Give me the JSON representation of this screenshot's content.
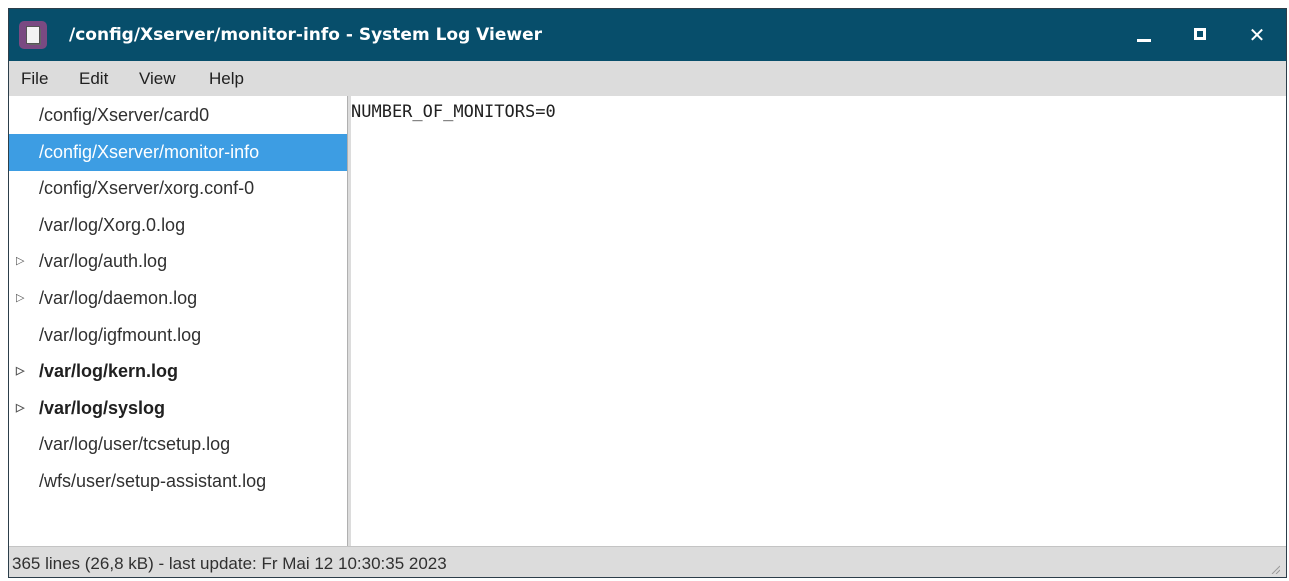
{
  "window": {
    "title": "/config/Xserver/monitor-info - System Log Viewer",
    "close_glyph": "✕"
  },
  "menu": [
    "File",
    "Edit",
    "View",
    "Help"
  ],
  "sidebar": {
    "items": [
      {
        "label": "/config/Xserver/card0",
        "expandable": false,
        "bold": false,
        "selected": false
      },
      {
        "label": "/config/Xserver/monitor-info",
        "expandable": false,
        "bold": false,
        "selected": true
      },
      {
        "label": "/config/Xserver/xorg.conf-0",
        "expandable": false,
        "bold": false,
        "selected": false
      },
      {
        "label": "/var/log/Xorg.0.log",
        "expandable": false,
        "bold": false,
        "selected": false
      },
      {
        "label": "/var/log/auth.log",
        "expandable": true,
        "bold": false,
        "selected": false
      },
      {
        "label": "/var/log/daemon.log",
        "expandable": true,
        "bold": false,
        "selected": false
      },
      {
        "label": "/var/log/igfmount.log",
        "expandable": false,
        "bold": false,
        "selected": false
      },
      {
        "label": "/var/log/kern.log",
        "expandable": true,
        "bold": true,
        "selected": false
      },
      {
        "label": "/var/log/syslog",
        "expandable": true,
        "bold": true,
        "selected": false
      },
      {
        "label": "/var/log/user/tcsetup.log",
        "expandable": false,
        "bold": false,
        "selected": false
      },
      {
        "label": "/wfs/user/setup-assistant.log",
        "expandable": false,
        "bold": false,
        "selected": false
      }
    ],
    "expander_glyph": "▷"
  },
  "content": {
    "text": "NUMBER_OF_MONITORS=0"
  },
  "status": {
    "text": "365 lines (26,8 kB) - last update: Fr Mai 12 10:30:35 2023"
  },
  "colors": {
    "titlebar": "#074e6b",
    "selection": "#3d9de3"
  }
}
